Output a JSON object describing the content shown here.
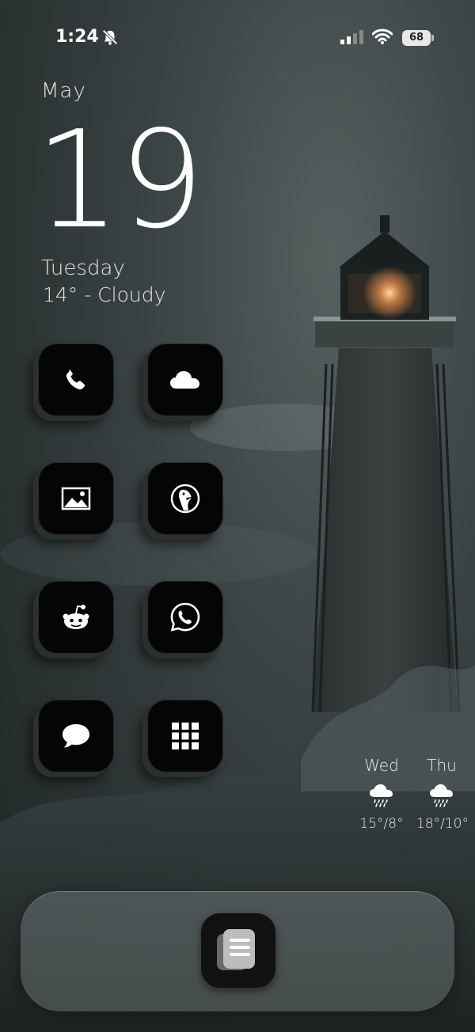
{
  "status": {
    "time": "1:24",
    "battery": "68"
  },
  "date": {
    "month": "May",
    "day": "19",
    "weekday": "Tuesday",
    "weather": "14° - Cloudy"
  },
  "apps": [
    {
      "name": "phone-app",
      "icon": "phone-icon"
    },
    {
      "name": "weather-app",
      "icon": "cloud-icon"
    },
    {
      "name": "photos-app",
      "icon": "image-icon"
    },
    {
      "name": "duckduckgo-app",
      "icon": "duck-icon"
    },
    {
      "name": "reddit-app",
      "icon": "reddit-icon"
    },
    {
      "name": "whatsapp-app",
      "icon": "whatsapp-icon"
    },
    {
      "name": "messages-app",
      "icon": "chat-bubble-icon"
    },
    {
      "name": "app-drawer",
      "icon": "grid-icon"
    }
  ],
  "forecast": [
    {
      "day": "Wed",
      "temps": "15°/8°",
      "icon": "rain-cloud-icon"
    },
    {
      "day": "Thu",
      "temps": "18°/10°",
      "icon": "rain-cloud-icon"
    }
  ],
  "dock": {
    "app": "notes-app",
    "icon": "stack-icon"
  }
}
